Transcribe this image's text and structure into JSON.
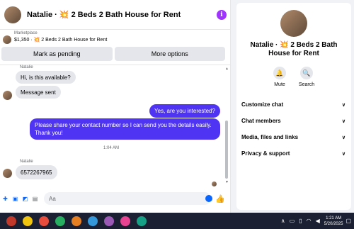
{
  "header": {
    "title": "Natalie · 💥 2 Beds 2 Bath House for Rent",
    "info_icon": "info-icon"
  },
  "marketplace": {
    "label": "Marketplace",
    "listing": "$1,350 · 💥 2 Beds 2 Bath House for Rent",
    "pending_label": "Mark as pending",
    "more_label": "More options"
  },
  "messages": {
    "sender_1": "Natalie",
    "msg_1": "Hi, is this available?",
    "msg_2": "Message sent",
    "out_1": "Yes, are you interested?",
    "out_2": "Please share your contact number so I can send you the details easily. Thank you!",
    "time": "1:04 AM",
    "sender_2": "Natalie",
    "msg_3": "6572267965"
  },
  "composer": {
    "placeholder": "Aa"
  },
  "panel": {
    "title": "Natalie · 💥 2 Beds 2 Bath House for Rent",
    "mute_label": "Mute",
    "search_label": "Search",
    "items": [
      {
        "label": "Customize chat"
      },
      {
        "label": "Chat members"
      },
      {
        "label": "Media, files and links"
      },
      {
        "label": "Privacy & support"
      }
    ]
  },
  "taskbar": {
    "time": "1:21 AM",
    "date": "5/20/2025"
  },
  "colors": {
    "outgoing_bubble": "#4f35f3",
    "accent": "#0866ff",
    "taskbar": "#1b2133"
  }
}
